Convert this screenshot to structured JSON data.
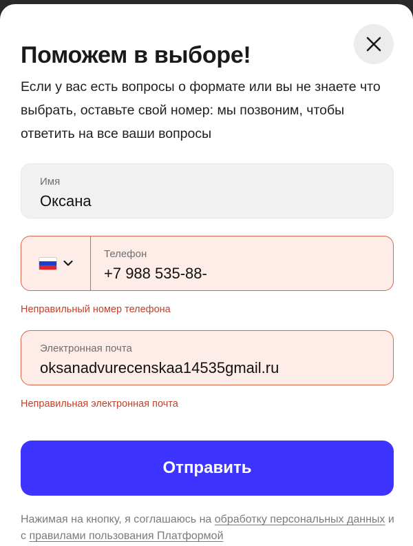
{
  "modal": {
    "title": "Поможем в выборе!",
    "subtitle": "Если у вас есть вопросы о формате или вы не знаете что выбрать, оставьте свой номер: мы позвоним, чтобы ответить на все ваши вопросы"
  },
  "form": {
    "name": {
      "label": "Имя",
      "value": "Оксана"
    },
    "phone": {
      "label": "Телефон",
      "value": "+7 988 535-88-",
      "country_icon": "russia-flag-icon",
      "error": "Неправильный номер телефона"
    },
    "email": {
      "label": "Электронная почта",
      "value": "oksanadvurecenskaa14535gmail.ru",
      "error": "Неправильная электронная почта"
    },
    "submit_label": "Отправить"
  },
  "legal": {
    "prefix": "Нажимая на кнопку, я соглашаюсь на ",
    "link1": "обработку персональных данных",
    "middle": " и с ",
    "link2": "правилами пользования Платформой"
  },
  "icons": {
    "close": "close-icon",
    "chevron": "chevron-down-icon"
  },
  "colors": {
    "accent": "#3d35ff",
    "error": "#c0412a",
    "error_bg": "#fdece8",
    "field_bg": "#f1f1f1",
    "flag": [
      "#ffffff",
      "#1c3fd0",
      "#e0262c"
    ]
  }
}
